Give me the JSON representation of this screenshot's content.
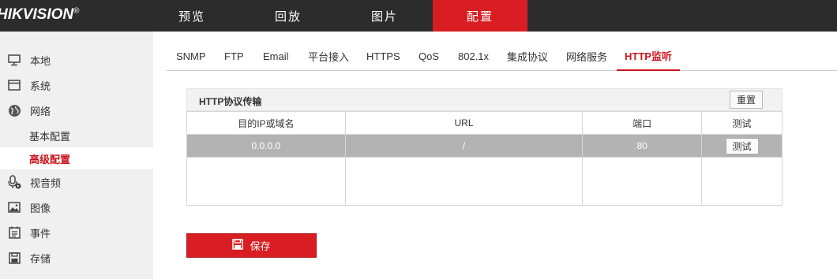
{
  "brand": {
    "logo": "HIKVISION",
    "reg": "®"
  },
  "topnav": [
    {
      "label": "预览"
    },
    {
      "label": "回放"
    },
    {
      "label": "图片"
    },
    {
      "label": "配置"
    }
  ],
  "sidebar": {
    "items": [
      {
        "label": "本地",
        "icon": "monitor-icon"
      },
      {
        "label": "系统",
        "icon": "system-icon"
      },
      {
        "label": "网络",
        "icon": "globe-icon"
      },
      {
        "label": "视音频",
        "icon": "mic-icon"
      },
      {
        "label": "图像",
        "icon": "image-icon"
      },
      {
        "label": "事件",
        "icon": "event-icon"
      },
      {
        "label": "存储",
        "icon": "storage-icon"
      }
    ],
    "subitems": [
      {
        "label": "基本配置"
      },
      {
        "label": "高级配置"
      }
    ]
  },
  "tabs": [
    {
      "label": "SNMP"
    },
    {
      "label": "FTP"
    },
    {
      "label": "Email"
    },
    {
      "label": "平台接入"
    },
    {
      "label": "HTTPS"
    },
    {
      "label": "QoS"
    },
    {
      "label": "802.1x"
    },
    {
      "label": "集成协议"
    },
    {
      "label": "网络服务"
    },
    {
      "label": "HTTP监听"
    }
  ],
  "panel": {
    "title": "HTTP协议传输",
    "reset_label": "重置",
    "columns": [
      "目的IP或域名",
      "URL",
      "端口",
      "测试"
    ],
    "rows": [
      {
        "ip": "0.0.0.0",
        "url": "/",
        "port": "80",
        "test_label": "测试"
      }
    ]
  },
  "save_label": "保存",
  "colors": {
    "accent": "#d81e22",
    "topbar": "#2c2c2c",
    "sidebar": "#f0f0f0",
    "selected_row": "#b3b3b3"
  }
}
